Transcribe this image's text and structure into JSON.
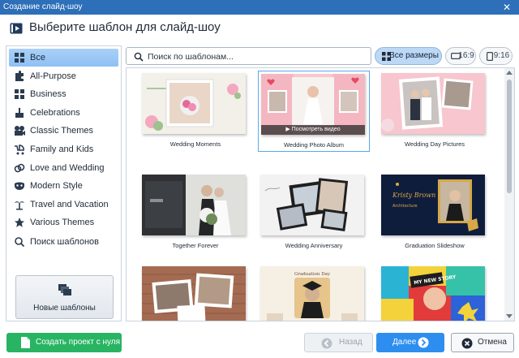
{
  "window": {
    "title": "Создание слайд-шоу",
    "close_glyph": "✕"
  },
  "header": {
    "title": "Выберите шаблон для слайд-шоу",
    "icon": "play-icon"
  },
  "sidebar": {
    "items": [
      {
        "label": "Все",
        "icon": "grid-icon",
        "active": true
      },
      {
        "label": "All-Purpose",
        "icon": "puzzle-icon"
      },
      {
        "label": "Business",
        "icon": "grid-icon"
      },
      {
        "label": "Celebrations",
        "icon": "cake-icon"
      },
      {
        "label": "Classic Themes",
        "icon": "film-icon"
      },
      {
        "label": "Family and Kids",
        "icon": "stroller-icon"
      },
      {
        "label": "Love and Wedding",
        "icon": "rings-icon"
      },
      {
        "label": "Modern Style",
        "icon": "mask-icon"
      },
      {
        "label": "Travel and Vacation",
        "icon": "palm-icon"
      },
      {
        "label": "Various Themes",
        "icon": "star-icon"
      },
      {
        "label": "Поиск шаблонов",
        "icon": "search-icon"
      }
    ],
    "new_templates_label": "Новые шаблоны"
  },
  "search": {
    "placeholder": "Поиск по шаблонам...",
    "value": ""
  },
  "sizes": [
    {
      "label": "Все размеры",
      "active": true
    },
    {
      "label": "16:9",
      "active": false
    },
    {
      "label": "9:16",
      "active": false
    }
  ],
  "templates": [
    {
      "caption": "Wedding Moments"
    },
    {
      "caption": "Wedding Photo Album",
      "selected": true,
      "overlay": "Посмотреть видео"
    },
    {
      "caption": "Wedding Day Pictures"
    },
    {
      "caption": "Together Forever"
    },
    {
      "caption": "Wedding Anniversary"
    },
    {
      "caption": "Graduation Slideshow",
      "thumb_title": "Kristy Brown",
      "thumb_subtitle": "Architecture"
    },
    {
      "caption": ""
    },
    {
      "caption": "",
      "thumb_title": "Graduation Day"
    },
    {
      "caption": "",
      "thumb_title": "MY NEW STORY"
    }
  ],
  "footer": {
    "create_label": "Создать проект с нуля",
    "back_label": "Назад",
    "next_label": "Далее",
    "cancel_label": "Отмена"
  },
  "colors": {
    "titlebar": "#2d6fb8",
    "accent": "#2d8ef0",
    "create": "#28b463",
    "active_nav": "#9ec9f5"
  }
}
